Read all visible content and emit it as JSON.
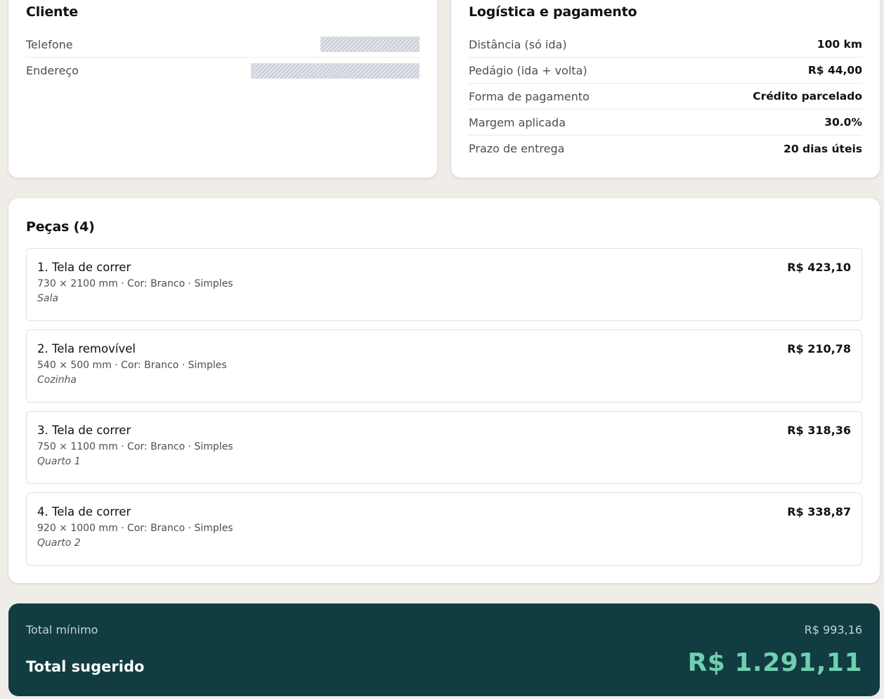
{
  "client": {
    "title": "Cliente",
    "fields": [
      {
        "label": "Telefone"
      },
      {
        "label": "Endereço"
      }
    ]
  },
  "logistics": {
    "title": "Logística e pagamento",
    "rows": [
      {
        "label": "Distância (só ida)",
        "value": "100 km"
      },
      {
        "label": "Pedágio (ida + volta)",
        "value": "R$ 44,00"
      },
      {
        "label": "Forma de pagamento",
        "value": "Crédito parcelado"
      },
      {
        "label": "Margem aplicada",
        "value": "30.0%"
      },
      {
        "label": "Prazo de entrega",
        "value": "20 dias úteis"
      }
    ]
  },
  "parts": {
    "title": "Peças (4)",
    "items": [
      {
        "name": "1. Tela de correr",
        "spec": "730 × 2100 mm · Cor: Branco · Simples",
        "room": "Sala",
        "price": "R$ 423,10"
      },
      {
        "name": "2. Tela removível",
        "spec": "540 × 500 mm · Cor: Branco · Simples",
        "room": "Cozinha",
        "price": "R$ 210,78"
      },
      {
        "name": "3. Tela de correr",
        "spec": "750 × 1100 mm · Cor: Branco · Simples",
        "room": "Quarto 1",
        "price": "R$ 318,36"
      },
      {
        "name": "4. Tela de correr",
        "spec": "920 × 1000 mm · Cor: Branco · Simples",
        "room": "Quarto 2",
        "price": "R$ 338,87"
      }
    ]
  },
  "totals": {
    "min_label": "Total mínimo",
    "min_value": "R$ 993,16",
    "suggested_label": "Total sugerido",
    "suggested_value": "R$ 1.291,11"
  },
  "colors": {
    "background": "#f0ede8",
    "totals_bg": "#113c42",
    "accent": "#6fcfae"
  }
}
